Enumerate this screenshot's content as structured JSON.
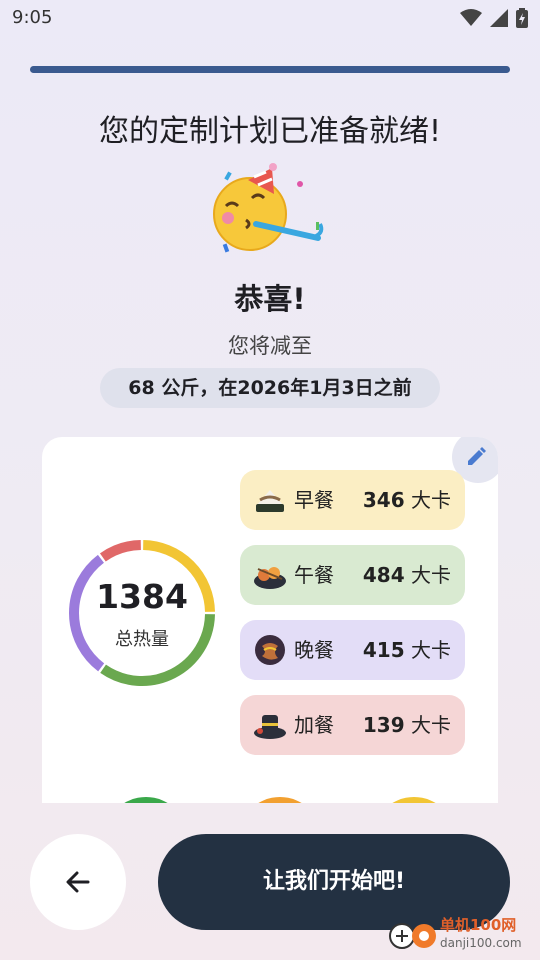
{
  "status_bar": {
    "time": "9:05"
  },
  "progress": {
    "fraction": 1.0
  },
  "headline": "您的定制计划已准备就绪!",
  "congrats": "恭喜!",
  "subtitle": "您将减至",
  "goal": "68 公斤，在2026年1月3日之前",
  "calories": {
    "total": "1384",
    "label": "总热量",
    "segments": [
      {
        "meal": "早餐",
        "value": 346,
        "color": "#f2c534"
      },
      {
        "meal": "午餐",
        "value": 484,
        "color": "#6aa84f"
      },
      {
        "meal": "晚餐",
        "value": 415,
        "color": "#9b7bdc"
      },
      {
        "meal": "加餐",
        "value": 139,
        "color": "#e06868"
      }
    ]
  },
  "meals": [
    {
      "name": "早餐",
      "kcal": "346",
      "unit": "大卡",
      "bg": "#fbeec4",
      "icon": "onigiri-icon"
    },
    {
      "name": "午餐",
      "kcal": "484",
      "unit": "大卡",
      "bg": "#d9ead1",
      "icon": "bento-icon"
    },
    {
      "name": "晚餐",
      "kcal": "415",
      "unit": "大卡",
      "bg": "#e3ddf7",
      "icon": "curry-icon"
    },
    {
      "name": "加餐",
      "kcal": "139",
      "unit": "大卡",
      "bg": "#f5d6d6",
      "icon": "snack-bowl-icon"
    }
  ],
  "buttons": {
    "cta": "让我们开始吧!"
  },
  "watermark": {
    "text": "单机100网",
    "url": "danji100.com"
  }
}
